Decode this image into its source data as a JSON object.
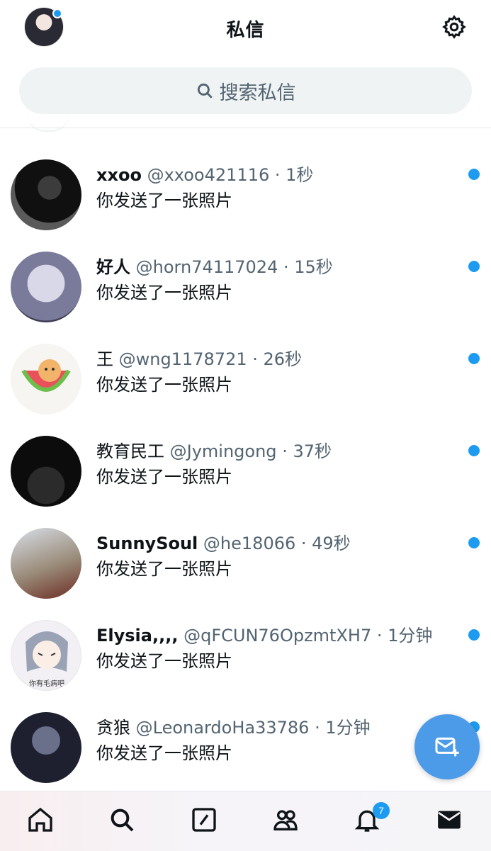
{
  "header": {
    "title": "私信"
  },
  "search": {
    "placeholder": "搜索私信"
  },
  "conversations": [
    {
      "name": "xxoo",
      "handle": "@xxoo421116",
      "time": "· 1秒",
      "preview": "你发送了一张照片",
      "unread": true
    },
    {
      "name": "好人",
      "handle": "@horn74117024",
      "time": "· 15秒",
      "preview": "你发送了一张照片",
      "unread": true
    },
    {
      "name": "王",
      "handle": "@wng1178721",
      "time": "· 26秒",
      "preview": "你发送了一张照片",
      "unread": true
    },
    {
      "name": "教育民工",
      "handle": "@Jymingong",
      "time": "· 37秒",
      "preview": "你发送了一张照片",
      "unread": true
    },
    {
      "name": "SunnySoul",
      "handle": "@he18066",
      "time": "· 49秒",
      "preview": "你发送了一张照片",
      "unread": true
    },
    {
      "name": "Elysia,,,,",
      "handle": "@qFCUN76OpzmtXH7",
      "time": "· 1分钟",
      "preview": "你发送了一张照片",
      "unread": true
    },
    {
      "name": "贪狼",
      "handle": "@LeonardoHa33786",
      "time": "· 1分钟",
      "preview": "你发送了一张照片",
      "unread": true
    }
  ],
  "avatar_captions": {
    "elysia": "你有毛病吧"
  },
  "nav": {
    "items": [
      "home-icon",
      "search-icon",
      "compose-post-icon",
      "communities-icon",
      "notifications-icon",
      "messages-icon"
    ],
    "notification_count": "7"
  },
  "colors": {
    "accent": "#1d9bf0",
    "fab": "#4c9be8",
    "text": "#0f1419",
    "secondary": "#536471"
  }
}
